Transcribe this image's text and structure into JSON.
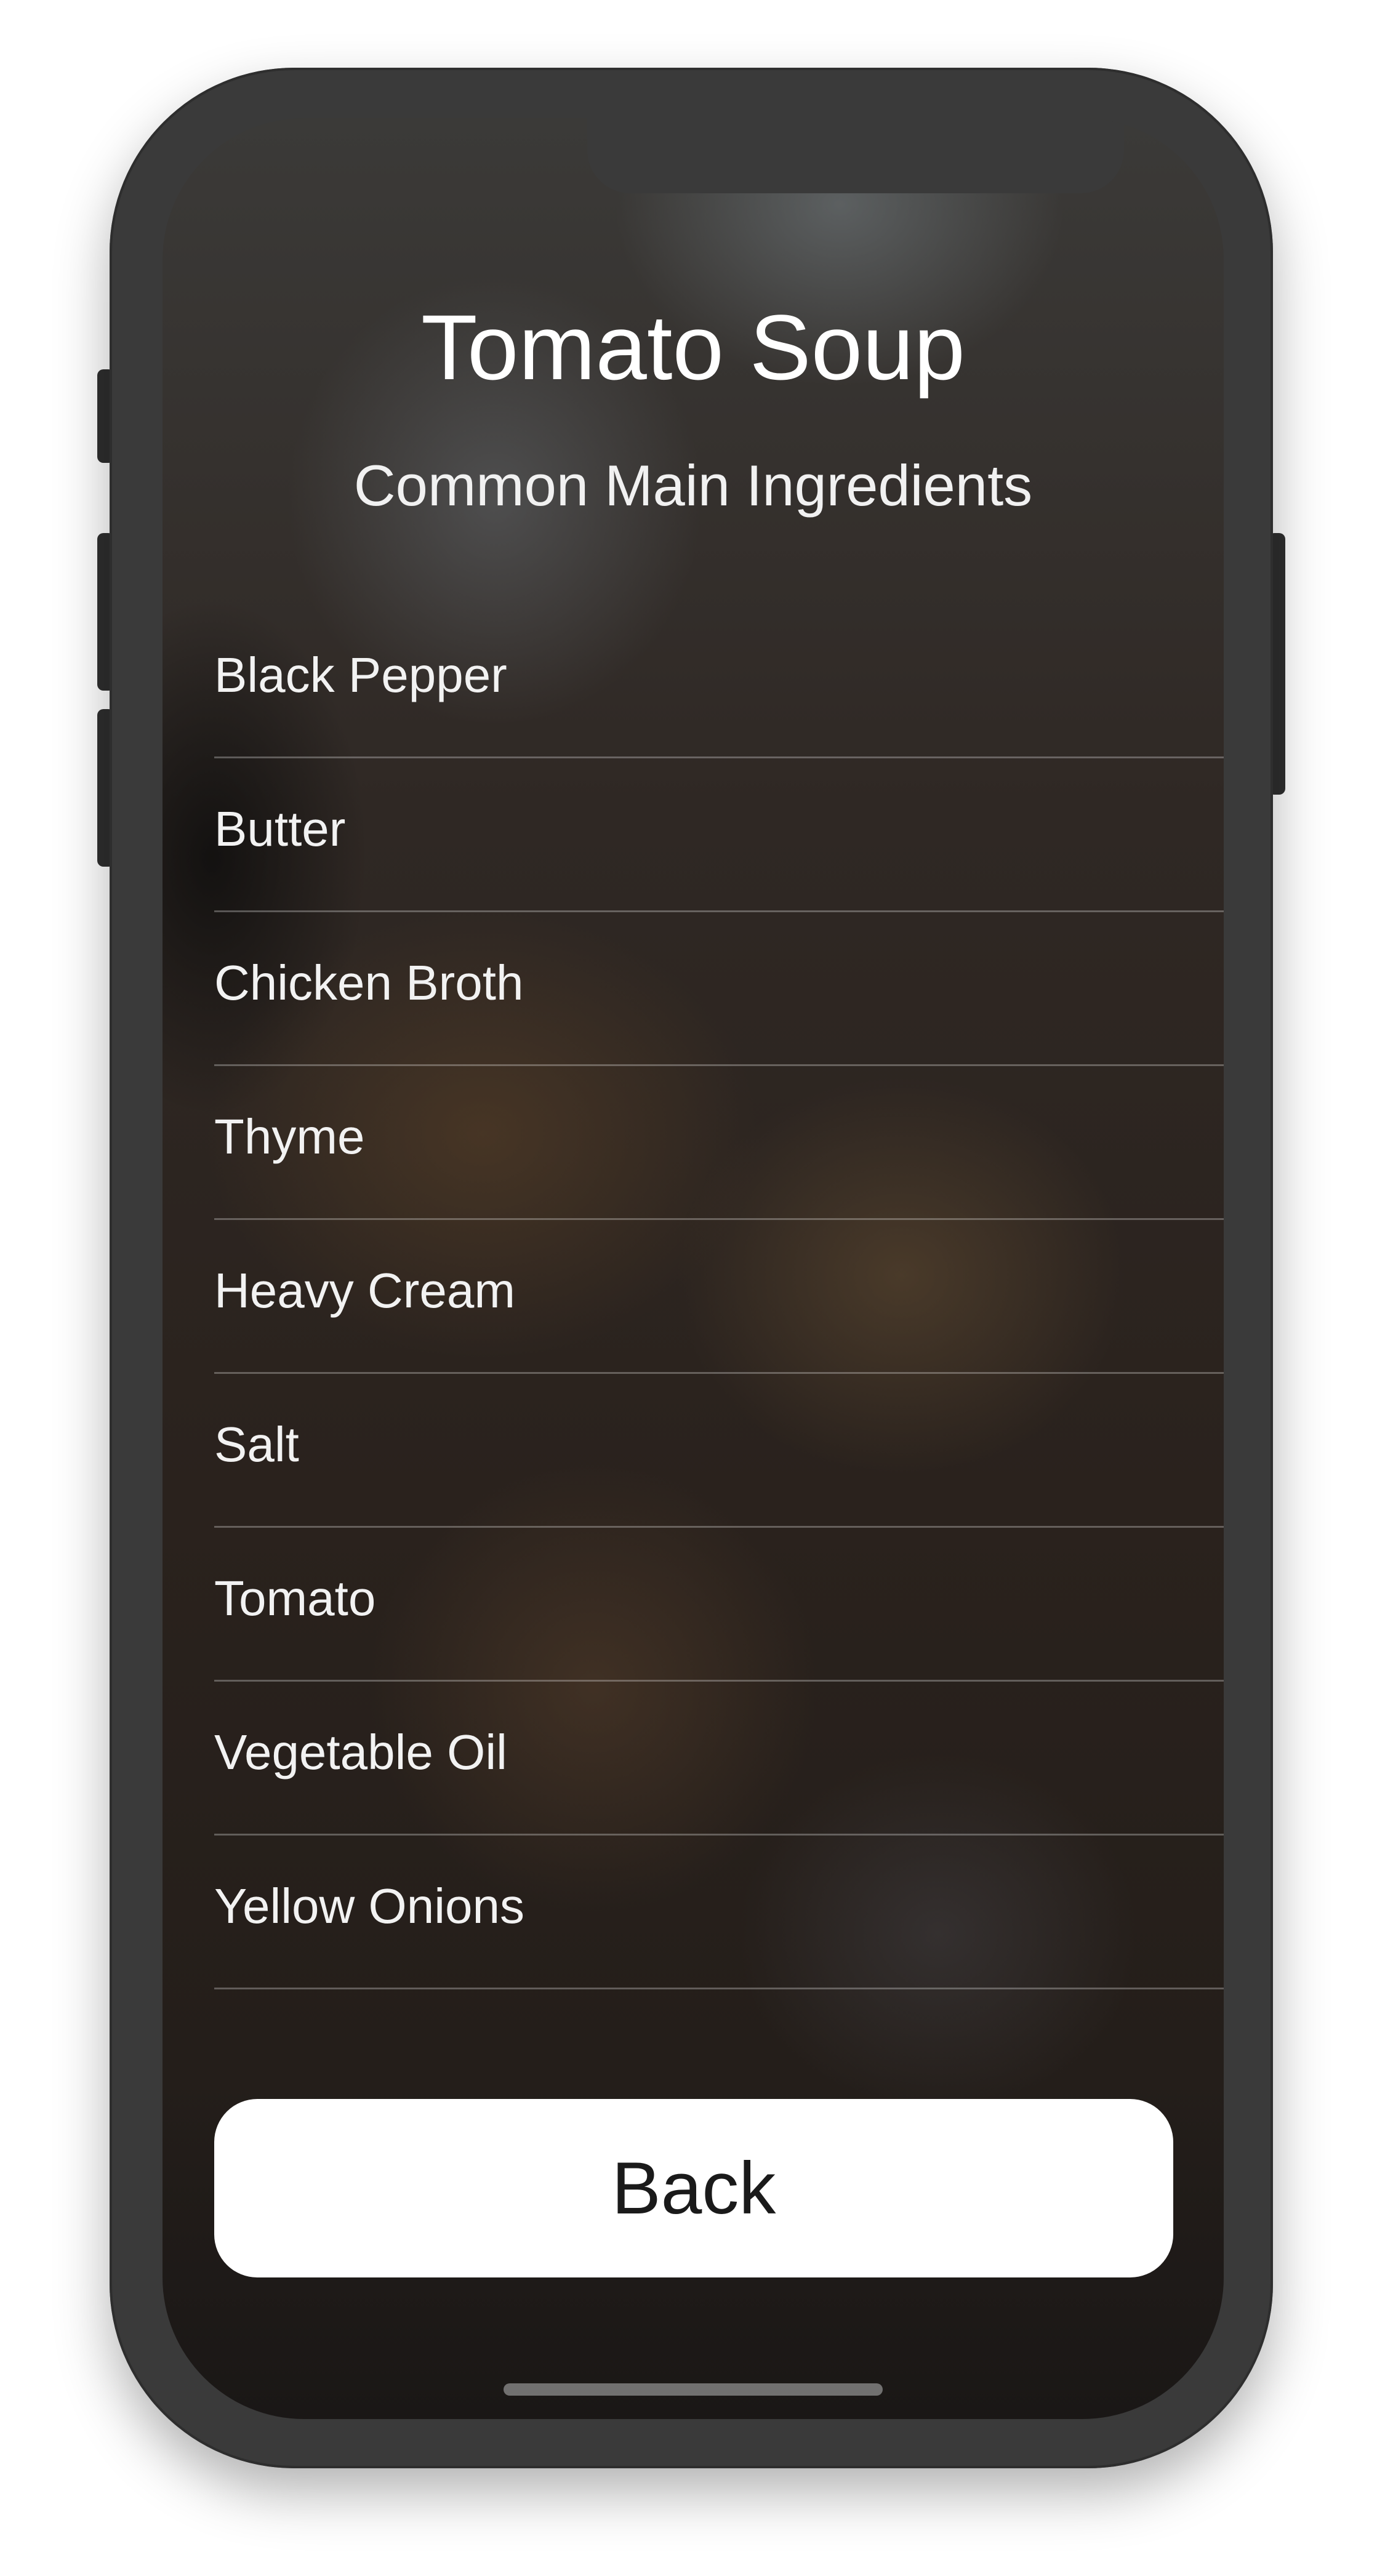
{
  "screen": {
    "title": "Tomato Soup",
    "subtitle": "Common Main Ingredients",
    "ingredients": [
      "Black Pepper",
      "Butter",
      "Chicken Broth",
      "Thyme",
      "Heavy Cream",
      "Salt",
      "Tomato",
      "Vegetable Oil",
      "Yellow Onions"
    ],
    "back_label": "Back"
  },
  "colors": {
    "button_background": "#ffffff",
    "text_primary": "#ffffff",
    "device_frame": "#3a3a3a"
  }
}
